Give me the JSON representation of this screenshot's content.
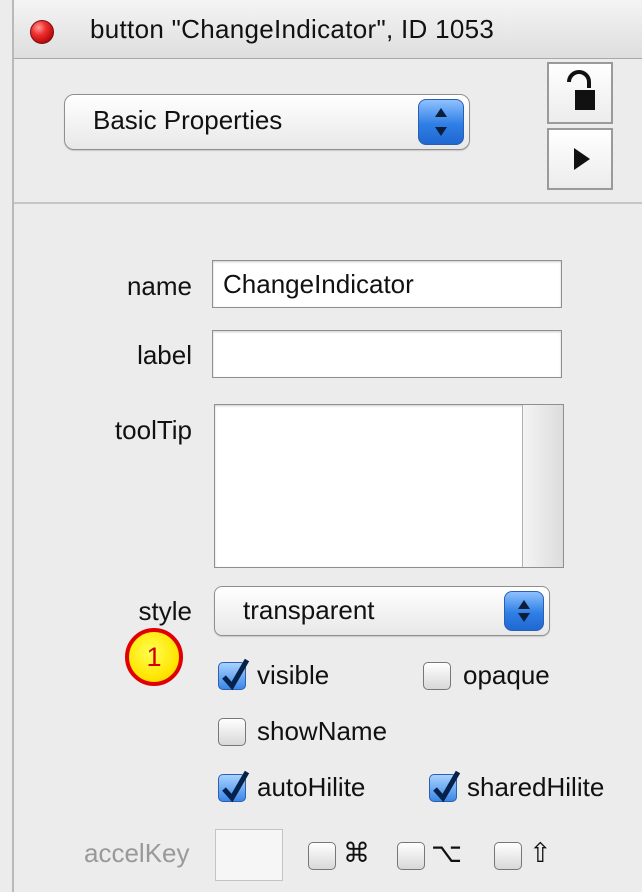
{
  "window": {
    "title": "button \"ChangeIndicator\", ID 1053"
  },
  "header": {
    "properties_popup": "Basic Properties"
  },
  "form": {
    "name_label": "name",
    "name_value": "ChangeIndicator",
    "label_label": "label",
    "label_value": "",
    "tooltip_label": "toolTip",
    "tooltip_value": "",
    "style_label": "style",
    "style_value": "transparent"
  },
  "options": {
    "visible": "visible",
    "opaque": "opaque",
    "showName": "showName",
    "autoHilite": "autoHilite",
    "sharedHilite": "sharedHilite"
  },
  "callout": {
    "badge": "1"
  },
  "accel": {
    "label": "accelKey",
    "value": "",
    "modifier_icons": [
      "command-icon",
      "option-icon",
      "shift-icon"
    ]
  },
  "colors": {
    "accent": "#2f7fe5",
    "badge_fill": "#ffe500",
    "badge_border": "#e00000"
  }
}
